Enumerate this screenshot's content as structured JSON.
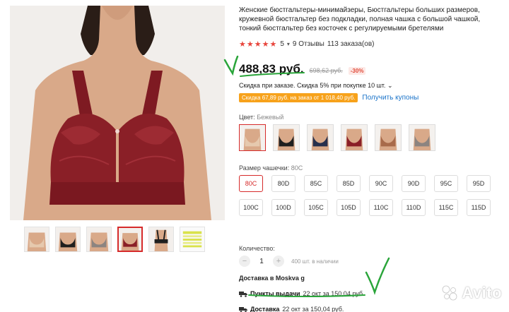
{
  "product": {
    "title": "Женские бюстгальтеры-минимайзеры, Бюстгальтеры больших размеров, кружевной бюстгальтер без подкладки, полная чашка с большой чашкой, тонкий бюстгальтер без косточек с регулируемыми бретелями",
    "rating_stars": "★★★★★",
    "rating_value": "5",
    "reviews": "9 Отзывы",
    "orders": "113 заказа(ов)"
  },
  "price": {
    "current": "488,83 руб.",
    "old": "698,62 руб.",
    "discount": "-30%"
  },
  "promo": {
    "text": "Скидка при заказе. Скидка 5% при покупке 10 шт.",
    "coupon_badge": "Скидка 67,89 руб. на заказ от 1 018,40 руб.",
    "coupon_link": "Получить купоны"
  },
  "color": {
    "label": "Цвет:",
    "selected": "Бежевый",
    "swatch_colors": [
      "#e6c9ae",
      "#1f1f1f",
      "#27304d",
      "#8a1f27",
      "#a86a4a",
      "#8c8480"
    ]
  },
  "size": {
    "label": "Размер чашечки:",
    "selected": "80C",
    "options": [
      "80C",
      "80D",
      "85C",
      "85D",
      "90C",
      "90D",
      "95C",
      "95D",
      "100C",
      "100D",
      "105C",
      "105D",
      "110C",
      "110D",
      "115C",
      "115D"
    ]
  },
  "quantity": {
    "label": "Количество:",
    "minus": "−",
    "value": "1",
    "plus": "+",
    "stock": "400 шт. в наличии"
  },
  "delivery": {
    "title": "Доставка в Moskva g",
    "pickup_label": "Пункты выдачи",
    "pickup_detail": "22 окт за 150,04 руб.",
    "courier_label": "Доставка",
    "courier_detail": "22 окт за 150,04 руб."
  },
  "gallery": {
    "thumb_colors": [
      "#e6c9ae",
      "#1f1f1f",
      "#8c8480",
      "#8a1f27",
      "#3a3a3a",
      "#d9e24a"
    ]
  },
  "watermark": {
    "text": "Avito"
  },
  "colors": {
    "accent": "#d62b2b",
    "link": "#1a73c9",
    "coupon": "#f7a21b",
    "annotation": "#2aa53a"
  }
}
